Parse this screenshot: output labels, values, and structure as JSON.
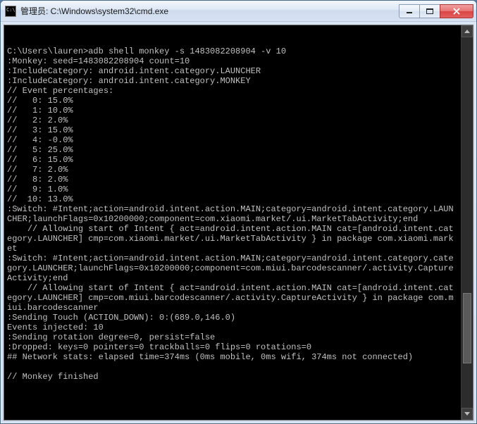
{
  "window": {
    "title": "管理员: C:\\Windows\\system32\\cmd.exe"
  },
  "console": {
    "prompt": "C:\\Users\\lauren>",
    "command": "adb shell monkey -s 1483082208904 -v 10",
    "lines": [
      ":Monkey: seed=1483082208904 count=10",
      ":IncludeCategory: android.intent.category.LAUNCHER",
      ":IncludeCategory: android.intent.category.MONKEY",
      "// Event percentages:",
      "//   0: 15.0%",
      "//   1: 10.0%",
      "//   2: 2.0%",
      "//   3: 15.0%",
      "//   4: -0.0%",
      "//   5: 25.0%",
      "//   6: 15.0%",
      "//   7: 2.0%",
      "//   8: 2.0%",
      "//   9: 1.0%",
      "//  10: 13.0%",
      ":Switch: #Intent;action=android.intent.action.MAIN;category=android.intent.category.LAUNCHER;launchFlags=0x10200000;component=com.xiaomi.market/.ui.MarketTabActivity;end",
      "    // Allowing start of Intent { act=android.intent.action.MAIN cat=[android.intent.category.LAUNCHER] cmp=com.xiaomi.market/.ui.MarketTabActivity } in package com.xiaomi.market",
      ":Switch: #Intent;action=android.intent.action.MAIN;category=android.intent.category.category.LAUNCHER;launchFlags=0x10200000;component=com.miui.barcodescanner/.activity.CaptureActivity;end",
      "    // Allowing start of Intent { act=android.intent.action.MAIN cat=[android.intent.category.LAUNCHER] cmp=com.miui.barcodescanner/.activity.CaptureActivity } in package com.miui.barcodescanner",
      ":Sending Touch (ACTION_DOWN): 0:(689.0,146.0)",
      "Events injected: 10",
      ":Sending rotation degree=0, persist=false",
      ":Dropped: keys=0 pointers=0 trackballs=0 flips=0 rotations=0",
      "## Network stats: elapsed time=374ms (0ms mobile, 0ms wifi, 374ms not connected)",
      "",
      "// Monkey finished"
    ]
  }
}
